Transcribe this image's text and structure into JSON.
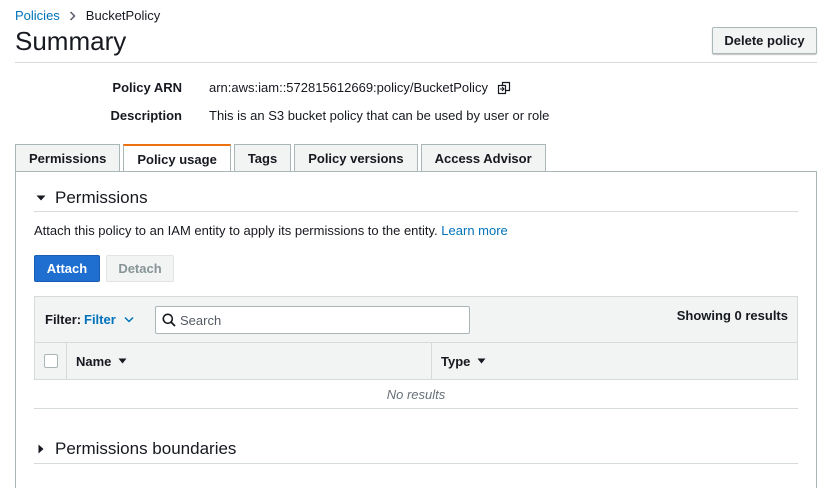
{
  "breadcrumb": {
    "parent": "Policies",
    "current": "BucketPolicy"
  },
  "page": {
    "title": "Summary",
    "delete_label": "Delete policy"
  },
  "summary": {
    "arn_label": "Policy ARN",
    "arn_value": "arn:aws:iam::572815612669:policy/BucketPolicy",
    "desc_label": "Description",
    "desc_value": "This is an S3 bucket policy that can be used by user or role"
  },
  "tabs": [
    {
      "label": "Permissions"
    },
    {
      "label": "Policy usage"
    },
    {
      "label": "Tags"
    },
    {
      "label": "Policy versions"
    },
    {
      "label": "Access Advisor"
    }
  ],
  "permissions": {
    "title": "Permissions",
    "description": "Attach this policy to an IAM entity to apply its permissions to the entity.",
    "learn_more": "Learn more",
    "attach_label": "Attach",
    "detach_label": "Detach",
    "filter_label": "Filter:",
    "filter_value": "Filter",
    "search_placeholder": "Search",
    "showing": "Showing 0 results",
    "columns": [
      "Name",
      "Type"
    ],
    "empty_text": "No results"
  },
  "boundaries": {
    "title": "Permissions boundaries"
  },
  "colors": {
    "link": "#0073bb",
    "primary": "#1f6fd1",
    "active_tab": "#ec7211"
  },
  "icons": {
    "copy": "copy-icon",
    "caret_down": "caret-down-icon",
    "caret_right": "caret-right-icon",
    "search": "search-icon"
  }
}
